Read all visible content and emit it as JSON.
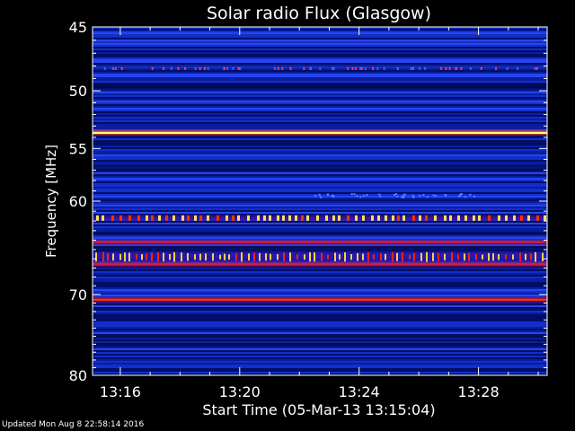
{
  "chart_data": {
    "type": "heatmap",
    "title": "Solar radio Flux (Glasgow)",
    "ylabel": "Frequency [MHz]",
    "xlabel": "Start Time (05-Mar-13 13:15:04)",
    "y_tick_labels": [
      "45",
      "50",
      "55",
      "60",
      "70",
      "80"
    ],
    "y_ticks": [
      45,
      50,
      55,
      60,
      70,
      80
    ],
    "ylim": [
      45,
      80
    ],
    "x_tick_labels": [
      "13:16",
      "13:20",
      "13:24",
      "13:28"
    ],
    "x_ticks_minutes": [
      16,
      20,
      24,
      28
    ],
    "xlim_minutes": [
      15.07,
      30.3
    ],
    "colors": {
      "background": "#000000",
      "low": "#000050",
      "mid": "#2040ff",
      "high": "#ff2000",
      "peak": "#ffff80",
      "frame": "#ffffff"
    },
    "emission_bands": [
      {
        "freq": 48.2,
        "intensity": 0.45,
        "pattern": "sparse"
      },
      {
        "freq": 53.6,
        "intensity": 1.0,
        "pattern": "continuous"
      },
      {
        "freq": 61.7,
        "intensity": 0.95,
        "pattern": "dashed"
      },
      {
        "freq": 64.2,
        "intensity": 0.6,
        "pattern": "continuous"
      },
      {
        "freq": 65.8,
        "intensity": 0.95,
        "pattern": "spiky"
      },
      {
        "freq": 66.6,
        "intensity": 0.8,
        "pattern": "continuous"
      },
      {
        "freq": 70.6,
        "intensity": 0.85,
        "pattern": "continuous"
      }
    ]
  },
  "footer": {
    "updated_text": "Updated Mon Aug  8 22:58:14 2016"
  }
}
